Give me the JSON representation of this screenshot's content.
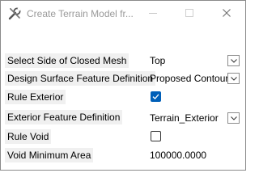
{
  "window": {
    "title": "Create Terrain Model fr..."
  },
  "form": {
    "rows": [
      {
        "label": "Select Side of Closed Mesh",
        "value": "Top"
      },
      {
        "label": "Design Surface Feature Definition",
        "value": "Proposed Contours"
      },
      {
        "label": "Rule Exterior",
        "checked": true
      },
      {
        "label": "Exterior Feature Definition",
        "value": "Terrain_Exterior"
      },
      {
        "label": "Rule Void",
        "checked": false
      },
      {
        "label": "Void Minimum Area",
        "value": "100000.0000"
      }
    ]
  },
  "colors": {
    "accent": "#005fb8",
    "label_background": "#f0f0f0",
    "title_text": "#9a9a9a"
  },
  "icons": {
    "app": "wrench-pencil-icon",
    "minimize": "minimize-icon",
    "maximize": "maximize-icon",
    "close": "close-icon",
    "dropdown": "chevron-down-icon",
    "check": "checkmark-icon"
  }
}
